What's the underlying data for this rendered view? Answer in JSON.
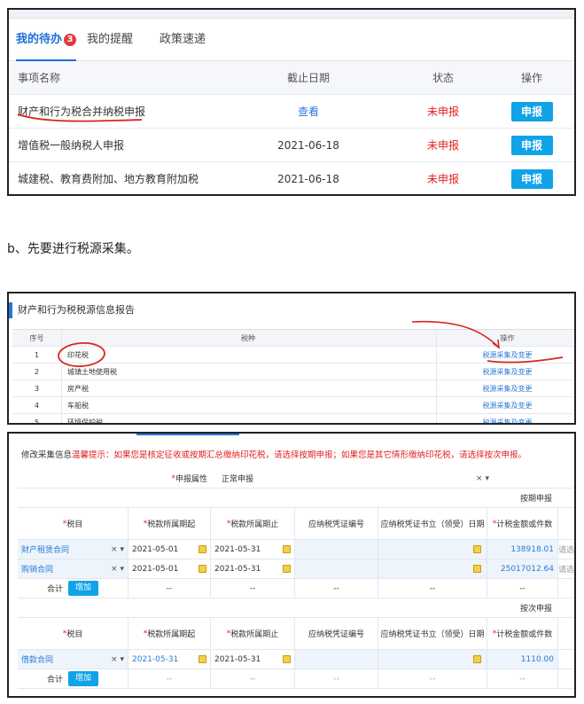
{
  "panel1": {
    "tabs": [
      {
        "label": "我的待办",
        "badge": "3"
      },
      {
        "label": "我的提醒"
      },
      {
        "label": "政策速递"
      }
    ],
    "columns": [
      "事项名称",
      "截止日期",
      "状态",
      "操作"
    ],
    "rows": [
      {
        "name": "财产和行为税合并纳税申报",
        "deadline": "查看",
        "status": "未申报",
        "action": "申报"
      },
      {
        "name": "增值税一般纳税人申报",
        "deadline": "2021-06-18",
        "status": "未申报",
        "action": "申报"
      },
      {
        "name": "城建税、教育费附加、地方教育附加税",
        "deadline": "2021-06-18",
        "status": "未申报",
        "action": "申报"
      }
    ]
  },
  "caption": "b、先要进行税源采集。",
  "panel2": {
    "title": "财产和行为税税源信息报告",
    "columns": [
      "序号",
      "税种",
      "操作"
    ],
    "rows": [
      {
        "no": "1",
        "tax": "印花税",
        "op": "税源采集及变更"
      },
      {
        "no": "2",
        "tax": "城镇土地使用税",
        "op": "税源采集及变更"
      },
      {
        "no": "3",
        "tax": "房产税",
        "op": "税源采集及变更"
      },
      {
        "no": "4",
        "tax": "车船税",
        "op": "税源采集及变更"
      },
      {
        "no": "5",
        "tax": "环境保护税",
        "op": "税源采集及变更"
      }
    ]
  },
  "panel3": {
    "title": "修改采集信息",
    "hint_label": "温馨提示：",
    "hint_text": "如果您是核定征收或按期汇总缴纳印花税，请选择按期申报；如果您是其它情形缴纳印花税，请选择按次申报。",
    "attr_label": "申报属性",
    "attr_value": "正常申报",
    "attr_clear": "×",
    "attr_arrow": "▾",
    "section1": "按期申报",
    "section2": "按次申报",
    "columns": [
      "税目",
      "税款所属期起",
      "税款所属期止",
      "应纳税凭证编号",
      "应纳税凭证书立（领受）日期",
      "计税金额或件数"
    ],
    "rows_period": [
      {
        "item": "财产租赁合同",
        "start": "2021-05-01",
        "end": "2021-05-31",
        "amount": "138918.01"
      },
      {
        "item": "购销合同",
        "start": "2021-05-01",
        "end": "2021-05-31",
        "amount": "25017012.64"
      }
    ],
    "rows_once": [
      {
        "item": "借款合同",
        "start": "2021-05-31",
        "end": "2021-05-31",
        "amount": "1110.00"
      }
    ],
    "total_label": "合计",
    "add_label": "增加",
    "dash": "--",
    "clear_sym": "×",
    "arrow_sym": "▾",
    "overflow_text": "请选"
  },
  "colors": {
    "primary": "#10a3e8",
    "link": "#2a7bd6",
    "alert": "#e02020",
    "annotation": "#d7281e"
  },
  "icons": [
    "calendar-icon",
    "clear-icon",
    "dropdown-arrow-icon"
  ]
}
